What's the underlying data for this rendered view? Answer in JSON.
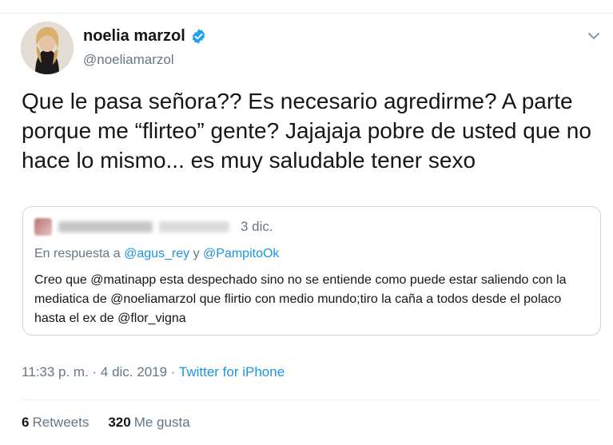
{
  "author": {
    "display_name": "noelia marzol",
    "handle": "@noeliamarzol",
    "verified": true
  },
  "tweet": {
    "text": "Que le pasa señora?? Es necesario agredirme? A parte porque me “flirteo” gente? Jajajaja pobre de usted que no hace lo mismo... es muy saludable tener sexo"
  },
  "quoted_tweet": {
    "date": "3 dic.",
    "reply_prefix": "En respuesta a ",
    "reply_user1": "@agus_rey",
    "reply_joiner": " y ",
    "reply_user2": "@PampitoOk",
    "body_1": "Creo que ",
    "mention_1": "@matinapp",
    "body_2": " esta despechado sino no se entiende como puede estar saliendo con la mediatica de ",
    "mention_2": "@noeliamarzol",
    "body_3": " que flirtio con medio mundo;tiro la caña a todos desde el polaco hasta el ex de ",
    "mention_3": "@flor_vigna"
  },
  "meta": {
    "timestamp": "11:33 p. m. · 4 dic. 2019 · ",
    "source": "Twitter for iPhone"
  },
  "stats": {
    "retweets_count": "6",
    "retweets_label": "Retweets",
    "likes_count": "320",
    "likes_label": "Me gusta"
  },
  "icons": {
    "verified": "verified-badge-icon",
    "menu": "chevron-down-icon"
  },
  "colors": {
    "link": "#1b95e0",
    "secondary": "#657786",
    "verified": "#1da1f2"
  }
}
